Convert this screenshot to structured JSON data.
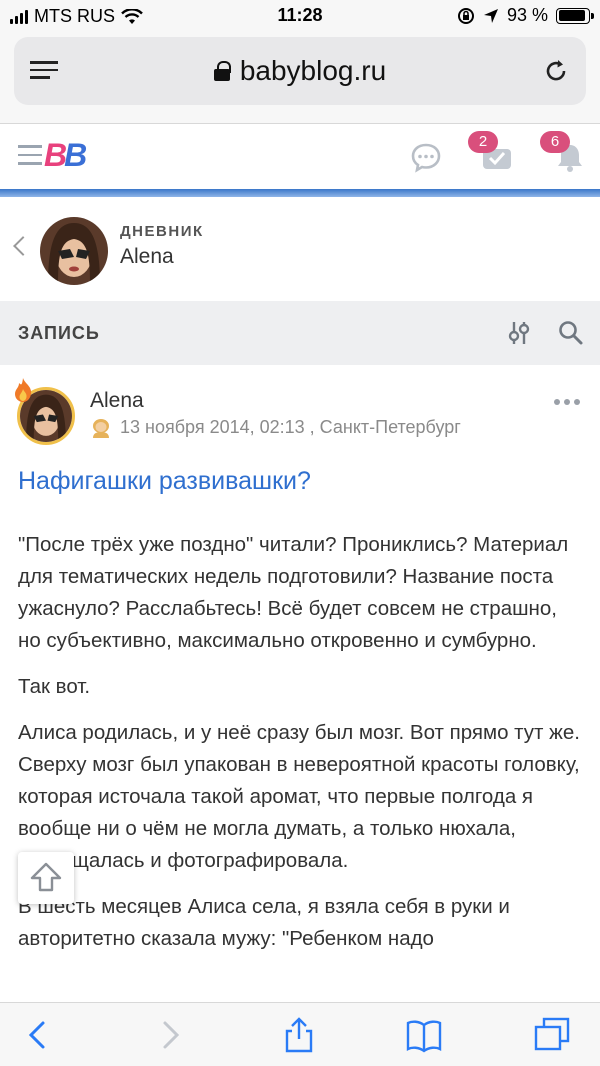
{
  "status_bar": {
    "carrier": "MTS RUS",
    "time": "11:28",
    "battery": "93 %",
    "battery_level": 0.93
  },
  "browser": {
    "url": "babyblog.ru"
  },
  "site_header": {
    "logo_text": "BB",
    "messages_badge": "",
    "tasks_badge": "2",
    "notifications_badge": "6",
    "colors": {
      "pink": "#e8417d",
      "blue": "#3a6fd6",
      "badge": "#d94f7c"
    }
  },
  "diary": {
    "label": "ДНЕВНИК",
    "name": "Alena"
  },
  "section": {
    "title": "ЗАПИСЬ"
  },
  "post": {
    "author": "Alena",
    "date": "13 ноября 2014, 02:13 , Санкт-Петербург",
    "title": "Нафигашки развивашки?",
    "paragraphs": [
      "\"После трёх уже поздно\" читали? Прониклись? Материал для тематических недель подготовили? Название поста ужаснуло? Расслабьтесь! Всё будет совсем не страшно, но субъективно, максимально откровенно и сумбурно.",
      "Так вот.",
      "Алиса родилась, и у неё сразу был мозг. Вот прямо тут же. Сверху мозг был упакован в невероятной красоты головку, которая источала такой аромат, что первые полгода я вообще ни о чём не могла думать, а только нюхала, восхищалась и фотографировала.",
      "В шесть месяцев Алиса села, я взяла себя в руки и авторитетно сказала мужу: \"Ребенком надо"
    ]
  },
  "icons": {
    "menu": "menu-lines-icon",
    "lock": "lock-icon",
    "reload": "reload-icon",
    "chat": "chat-bubble-icon",
    "check": "check-icon",
    "bell": "bell-icon",
    "filter": "filter-icon",
    "search": "search-icon",
    "more": "more-dots-icon",
    "up": "scroll-up-icon"
  }
}
